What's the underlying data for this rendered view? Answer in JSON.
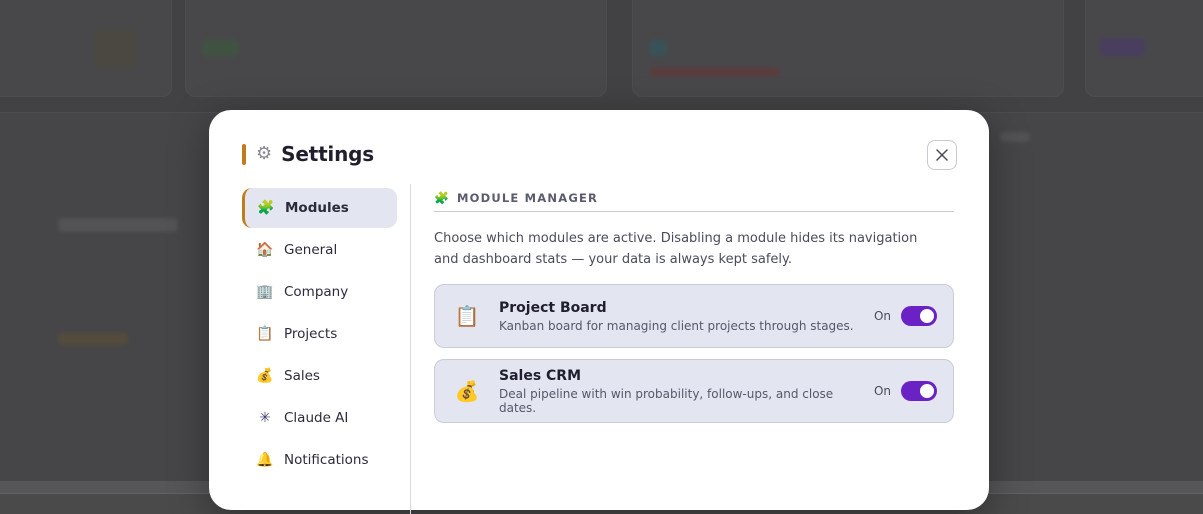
{
  "modal": {
    "title": "Settings",
    "title_icon": "gear-icon",
    "accent_color": "#c07d1e",
    "close_icon": "close-icon"
  },
  "sidebar": {
    "items": [
      {
        "label": "Modules",
        "icon": "puzzle-icon",
        "glyph": "🧩",
        "active": true
      },
      {
        "label": "General",
        "icon": "house-icon",
        "glyph": "🏠",
        "active": false
      },
      {
        "label": "Company",
        "icon": "building-icon",
        "glyph": "🏢",
        "active": false
      },
      {
        "label": "Projects",
        "icon": "clipboard-icon",
        "glyph": "📋",
        "active": false
      },
      {
        "label": "Sales",
        "icon": "money-bag-icon",
        "glyph": "💰",
        "active": false
      },
      {
        "label": "Claude AI",
        "icon": "sparkle-icon",
        "glyph": "✳",
        "active": false
      },
      {
        "label": "Notifications",
        "icon": "bell-icon",
        "glyph": "🔔",
        "active": false
      }
    ]
  },
  "main": {
    "section_title": "MODULE MANAGER",
    "section_icon": "puzzle-icon",
    "description": "Choose which modules are active. Disabling a module hides its navigation and dashboard stats — your data is always kept safely.",
    "modules": [
      {
        "name": "Project Board",
        "description": "Kanban board for managing client projects through stages.",
        "state": "On",
        "enabled": true,
        "icon": "clipboard-icon"
      },
      {
        "name": "Sales CRM",
        "description": "Deal pipeline with win probability, follow-ups, and close dates.",
        "state": "On",
        "enabled": true,
        "icon": "money-bag-icon"
      }
    ],
    "toggle_color": "#6a22c5"
  }
}
